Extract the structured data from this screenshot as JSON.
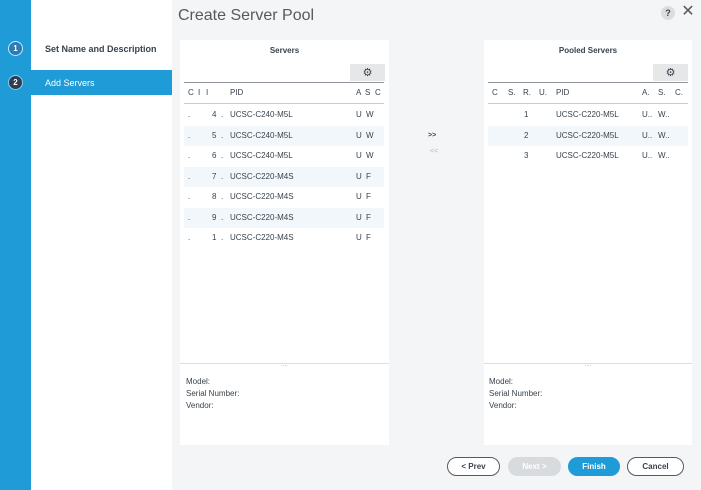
{
  "wizard": {
    "title": "Create Server Pool",
    "help_label": "?",
    "close_label": "✕",
    "steps": [
      {
        "number": "1",
        "label": "Set Name and Description",
        "active": false
      },
      {
        "number": "2",
        "label": "Add Servers",
        "active": true
      }
    ]
  },
  "servers_panel": {
    "title": "Servers",
    "gear_label": "⚙",
    "columns": [
      "C",
      "I",
      "I",
      "PID",
      "A",
      "S",
      "C"
    ],
    "rows": [
      {
        "c1": ".",
        "c2": "4",
        "c3": ".",
        "pid": "UCSC-C240-M5L",
        "c5": "U",
        "c6": "W",
        "c7": "("
      },
      {
        "c1": ".",
        "c2": "5",
        "c3": ".",
        "pid": "UCSC-C240-M5L",
        "c5": "U",
        "c6": "W",
        "c7": "("
      },
      {
        "c1": ".",
        "c2": "6",
        "c3": ".",
        "pid": "UCSC-C240-M5L",
        "c5": "U",
        "c6": "W",
        "c7": "("
      },
      {
        "c1": ".",
        "c2": "7",
        "c3": ".",
        "pid": "UCSC-C220-M4S",
        "c5": "U",
        "c6": "F",
        "c7": "("
      },
      {
        "c1": ".",
        "c2": "8",
        "c3": ".",
        "pid": "UCSC-C220-M4S",
        "c5": "U",
        "c6": "F",
        "c7": "("
      },
      {
        "c1": ".",
        "c2": "9",
        "c3": ".",
        "pid": "UCSC-C220-M4S",
        "c5": "U",
        "c6": "F",
        "c7": "("
      },
      {
        "c1": ".",
        "c2": "1",
        "c3": ".",
        "pid": "UCSC-C220-M4S",
        "c5": "U",
        "c6": "F",
        "c7": "("
      }
    ],
    "divider": "....",
    "details": {
      "model": "Model:",
      "serial": "Serial Number:",
      "vendor": "Vendor:"
    }
  },
  "pooled_panel": {
    "title": "Pooled Servers",
    "gear_label": "⚙",
    "columns": [
      "C",
      "S.",
      "R.",
      "U.",
      "PID",
      "A.",
      "S.",
      "C."
    ],
    "rows": [
      {
        "r": "1",
        "pid": "UCSC-C220-M5L",
        "a": "U..",
        "s": "W.."
      },
      {
        "r": "2",
        "pid": "UCSC-C220-M5L",
        "a": "U..",
        "s": "W.."
      },
      {
        "r": "3",
        "pid": "UCSC-C220-M5L",
        "a": "U..",
        "s": "W.."
      }
    ],
    "divider": "....",
    "details": {
      "model": "Model:",
      "serial": "Serial Number:",
      "vendor": "Vendor:"
    }
  },
  "transfer": {
    "add_label": ">>",
    "remove_label": "<<"
  },
  "footer": {
    "prev": "< Prev",
    "next": "Next >",
    "finish": "Finish",
    "cancel": "Cancel"
  },
  "colors": {
    "accent": "#1f9bd8",
    "panel_bg": "#ffffff",
    "content_bg": "#f4f5f6"
  }
}
